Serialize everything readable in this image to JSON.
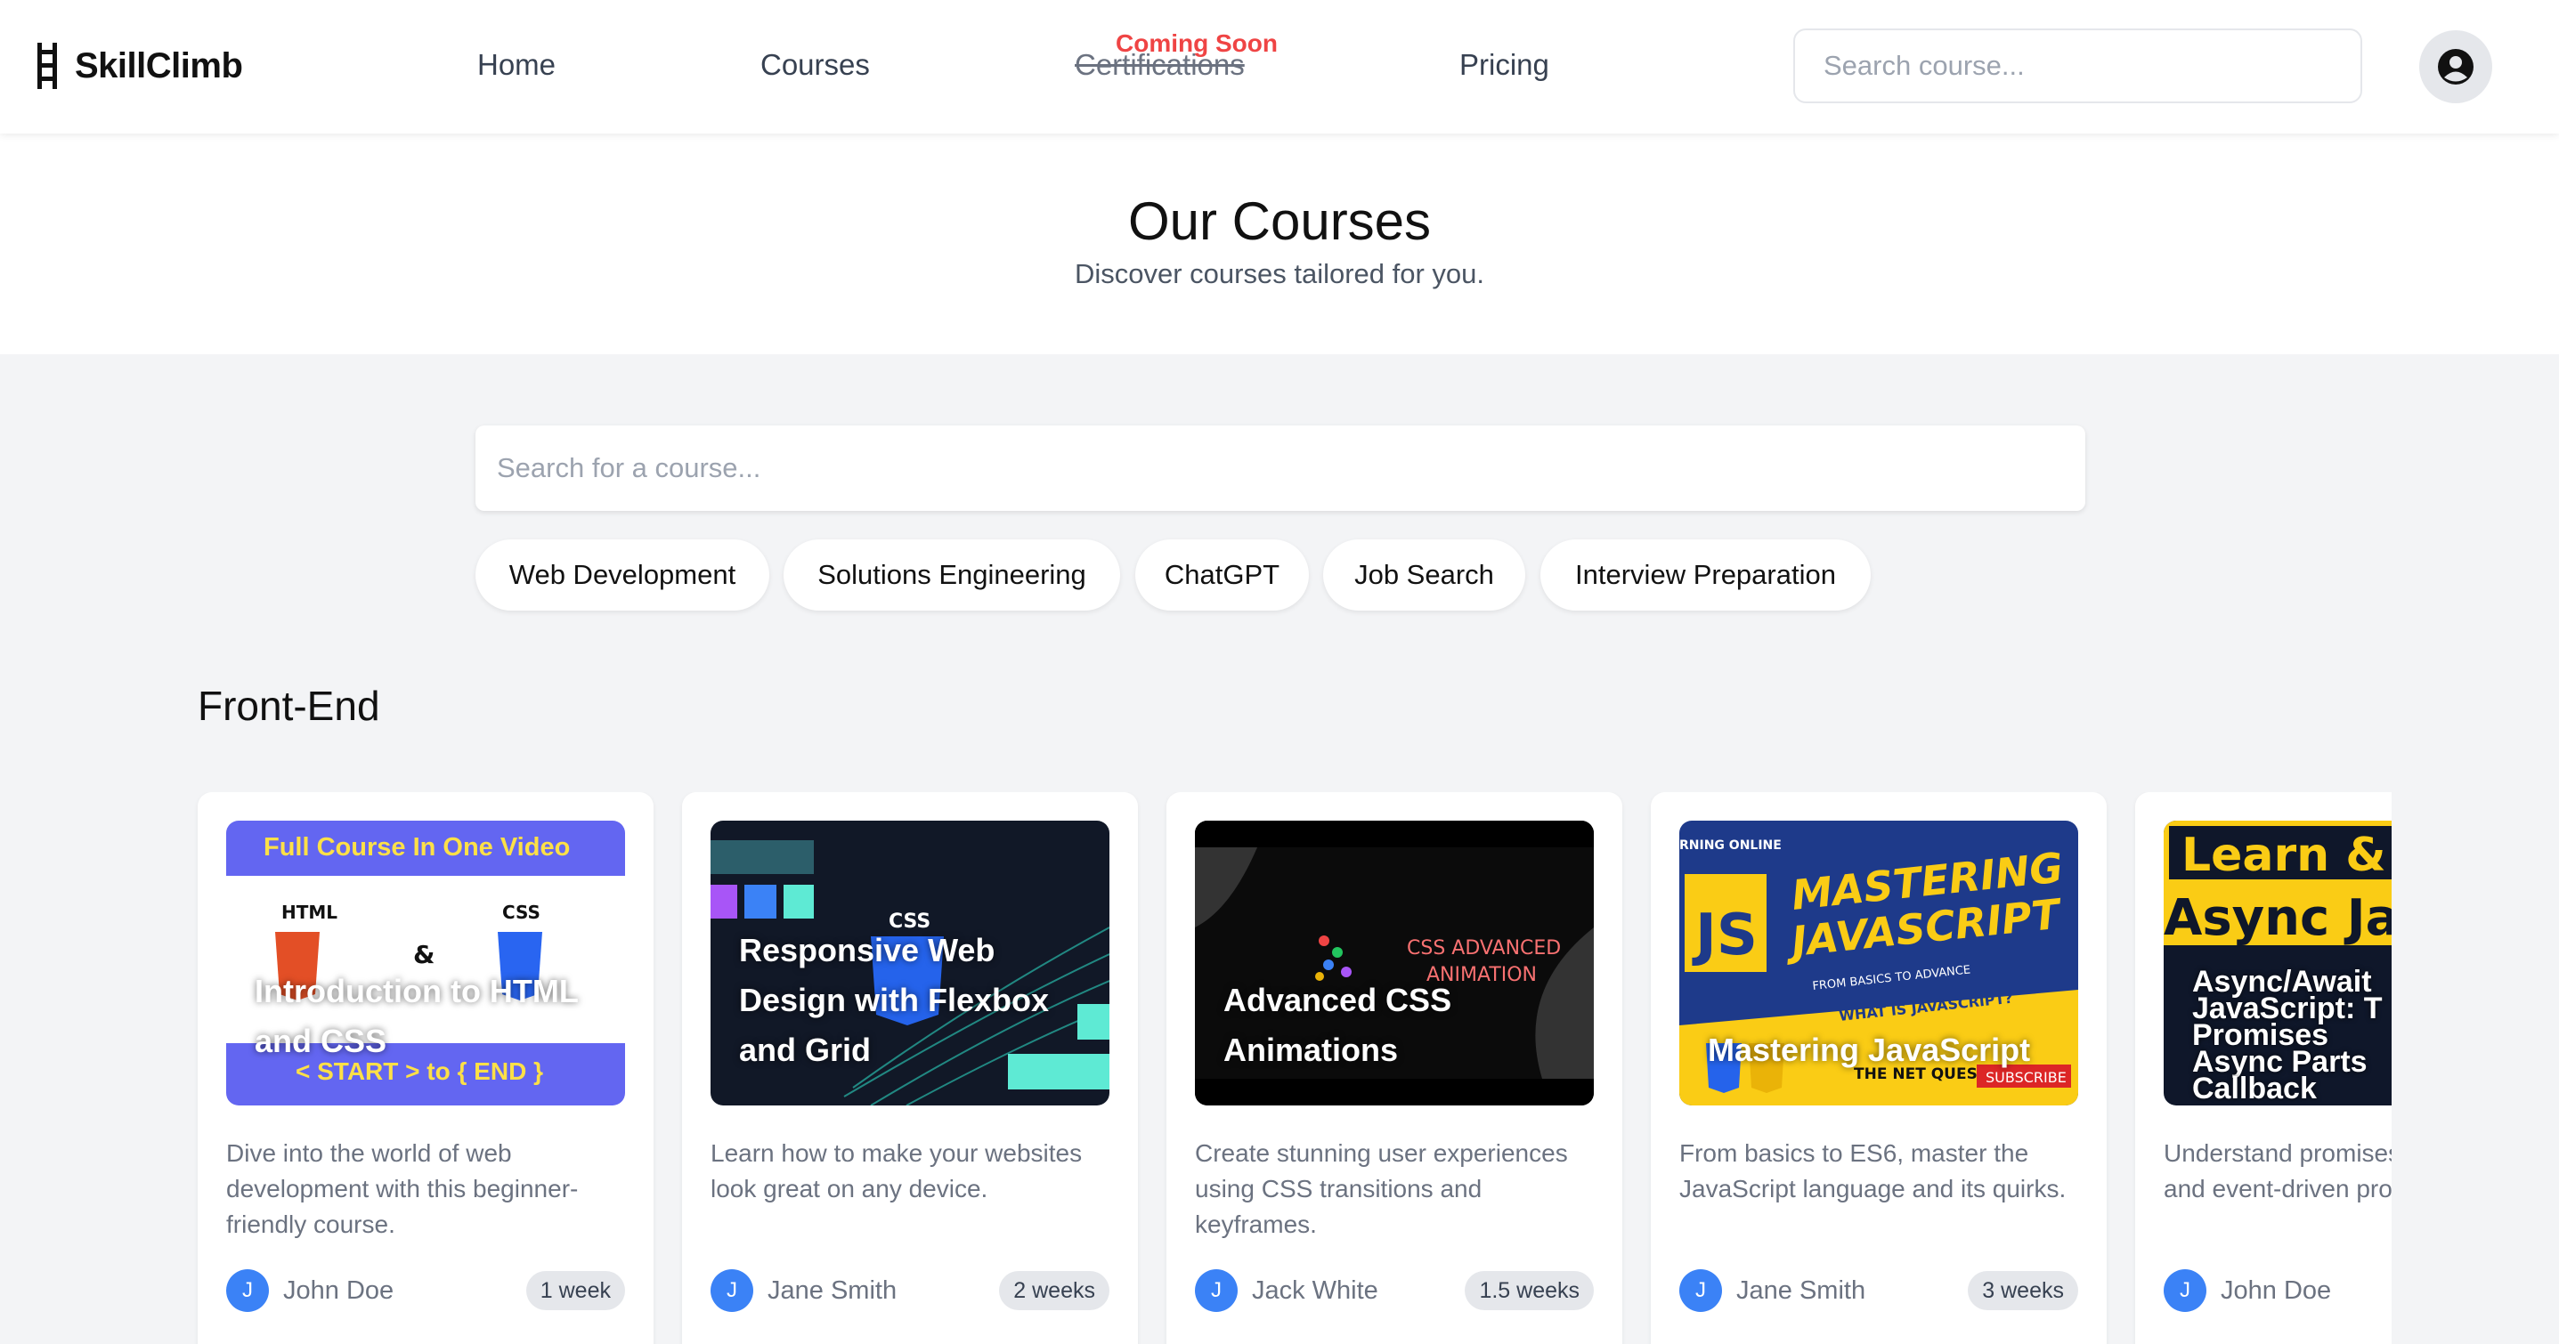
{
  "brand": {
    "name": "SkillClimb"
  },
  "nav": {
    "home": "Home",
    "courses": "Courses",
    "certifications": "Certifications",
    "coming_soon": "Coming Soon",
    "pricing": "Pricing",
    "search_placeholder": "Search course..."
  },
  "hero": {
    "title": "Our Courses",
    "subtitle": "Discover courses tailored for you."
  },
  "main_search": {
    "placeholder": "Search for a course..."
  },
  "chips": [
    "Web Development",
    "Solutions Engineering",
    "ChatGPT",
    "Job Search",
    "Interview Preparation"
  ],
  "section": {
    "title": "Front-End"
  },
  "thumbnails": {
    "html_css": {
      "banner": "Full Course In One Video",
      "html": "HTML",
      "css": "CSS",
      "amp": "&",
      "footer": "< START > to { END }"
    },
    "flexbox": {
      "css": "CSS"
    },
    "animations": {
      "line1": "CSS ADVANCED",
      "line2": "ANIMATION"
    },
    "javascript": {
      "tag": "RNING ONLINE",
      "line1": "MASTERING",
      "line2": "JAVASCRIPT",
      "sub": "FROM BASICS TO ADVANCE",
      "q": "WHAT IS JAVASCRIPT?",
      "channel": "THE NET QUEST1",
      "subscribe": "SUBSCRIBE"
    },
    "async": {
      "line1": "Learn & M",
      "line2": "Async Jav"
    }
  },
  "courses": [
    {
      "title": "Introduction to HTML and CSS",
      "description": "Dive into the world of web development with this beginner-friendly course.",
      "author_initial": "J",
      "author": "John Doe",
      "duration": "1 week"
    },
    {
      "title": "Responsive Web Design with Flexbox and Grid",
      "description": "Learn how to make your websites look great on any device.",
      "author_initial": "J",
      "author": "Jane Smith",
      "duration": "2 weeks"
    },
    {
      "title": "Advanced CSS Animations",
      "description": "Create stunning user experiences using CSS transitions and keyframes.",
      "author_initial": "J",
      "author": "Jack White",
      "duration": "1.5 weeks"
    },
    {
      "title": "Mastering JavaScript",
      "description": "From basics to ES6, master the JavaScript language and its quirks.",
      "author_initial": "J",
      "author": "Jane Smith",
      "duration": "3 weeks"
    },
    {
      "title": "Async/Await, Promises, Callback",
      "description": "Understand promises, async/await, and event-driven programming.",
      "author_initial": "J",
      "author": "John Doe",
      "duration": ""
    }
  ],
  "card5_thumb_text": [
    "Async/Await",
    "JavaScript: T",
    "Promises",
    "Async Parts",
    "Callback"
  ]
}
